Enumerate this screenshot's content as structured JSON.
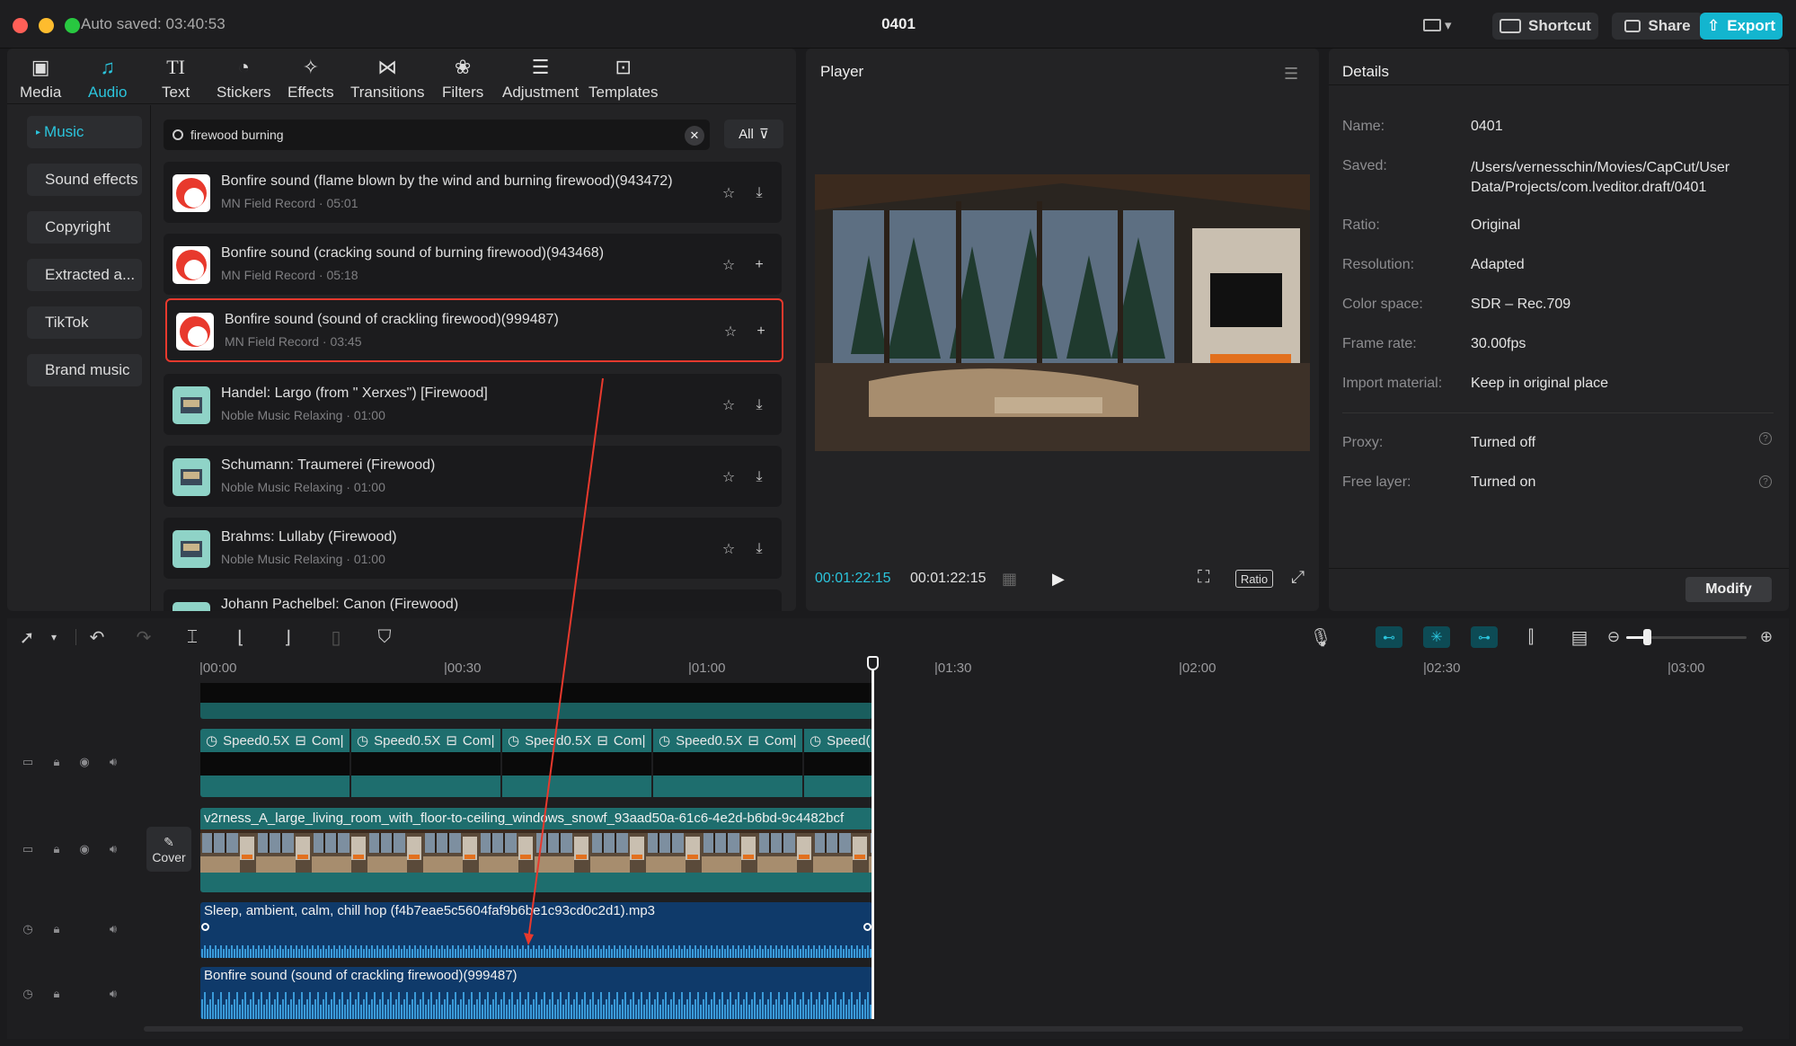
{
  "window": {
    "autosave": "Auto saved: 03:40:53",
    "title": "0401",
    "shortcut_label": "Shortcut",
    "share_label": "Share",
    "export_label": "Export"
  },
  "toolbar": {
    "tabs": [
      {
        "label": "Media",
        "icon": "media-icon"
      },
      {
        "label": "Audio",
        "icon": "audio-icon"
      },
      {
        "label": "Text",
        "icon": "text-icon"
      },
      {
        "label": "Stickers",
        "icon": "stickers-icon"
      },
      {
        "label": "Effects",
        "icon": "effects-icon"
      },
      {
        "label": "Transitions",
        "icon": "transitions-icon"
      },
      {
        "label": "Filters",
        "icon": "filters-icon"
      },
      {
        "label": "Adjustment",
        "icon": "adjustment-icon"
      },
      {
        "label": "Templates",
        "icon": "templates-icon"
      }
    ],
    "active": "Audio"
  },
  "sidebar": {
    "items": [
      "Music",
      "Sound effects",
      "Copyright",
      "Extracted a...",
      "TikTok",
      "Brand music"
    ],
    "active": "Music"
  },
  "search": {
    "value": "firewood burning",
    "filter_label": "All"
  },
  "results": [
    {
      "title": "Bonfire sound (flame blown by the wind and burning firewood)(943472)",
      "sub": "MN Field Record · 05:01",
      "thumb": "red",
      "action": "download"
    },
    {
      "title": "Bonfire sound (cracking sound of burning firewood)(943468)",
      "sub": "MN Field Record · 05:18",
      "thumb": "red",
      "action": "add"
    },
    {
      "title": "Bonfire sound (sound of crackling firewood)(999487)",
      "sub": "MN Field Record · 03:45",
      "thumb": "red",
      "action": "add",
      "selected": true
    },
    {
      "title": "Handel: Largo (from \" Xerxes\") [Firewood]",
      "sub": "Noble Music Relaxing · 01:00",
      "thumb": "teal",
      "action": "download"
    },
    {
      "title": "Schumann: Traumerei (Firewood)",
      "sub": "Noble Music Relaxing · 01:00",
      "thumb": "teal",
      "action": "download"
    },
    {
      "title": "Brahms: Lullaby (Firewood)",
      "sub": "Noble Music Relaxing · 01:00",
      "thumb": "teal",
      "action": "download"
    },
    {
      "title": "Johann Pachelbel: Canon (Firewood)",
      "sub": "",
      "thumb": "teal",
      "action": "download"
    }
  ],
  "player": {
    "title": "Player",
    "time_current": "00:01:22:15",
    "time_total": "00:01:22:15",
    "ratio_label": "Ratio"
  },
  "details": {
    "title": "Details",
    "rows": [
      {
        "label": "Name:",
        "value": "0401"
      },
      {
        "label": "Saved:",
        "value": "/Users/vernesschin/Movies/CapCut/User Data/Projects/com.lveditor.draft/0401"
      },
      {
        "label": "Ratio:",
        "value": "Original"
      },
      {
        "label": "Resolution:",
        "value": "Adapted"
      },
      {
        "label": "Color space:",
        "value": "SDR – Rec.709"
      },
      {
        "label": "Frame rate:",
        "value": "30.00fps"
      },
      {
        "label": "Import material:",
        "value": "Keep in original place"
      },
      {
        "label": "Proxy:",
        "value": "Turned off"
      },
      {
        "label": "Free layer:",
        "value": "Turned on"
      }
    ],
    "modify_label": "Modify"
  },
  "timeline": {
    "ruler": [
      "|00:00",
      "|00:30",
      "|01:00",
      "|01:30",
      "|02:00",
      "|02:30",
      "|03:00"
    ],
    "speed_label": "Speed0.5X",
    "comp_label": "Com|",
    "speed_tail": "Speed(",
    "video_clip_name": "v2rness_A_large_living_room_with_floor-to-ceiling_windows_snowf_93aad50a-61c6-4e2d-b6bd-9c4482bcf",
    "cover_label": "Cover",
    "audio1_name": "Sleep, ambient, calm, chill hop (f4b7eae5c5604faf9b6be1c93cd0c2d1).mp3",
    "audio2_name": "Bonfire sound (sound of crackling firewood)(999487)"
  },
  "colors": {
    "accent": "#2bc4dc",
    "export": "#13b5cf",
    "selection": "#e8392d",
    "video_track": "#1e6e6e",
    "audio_track": "#0f3a6a"
  }
}
